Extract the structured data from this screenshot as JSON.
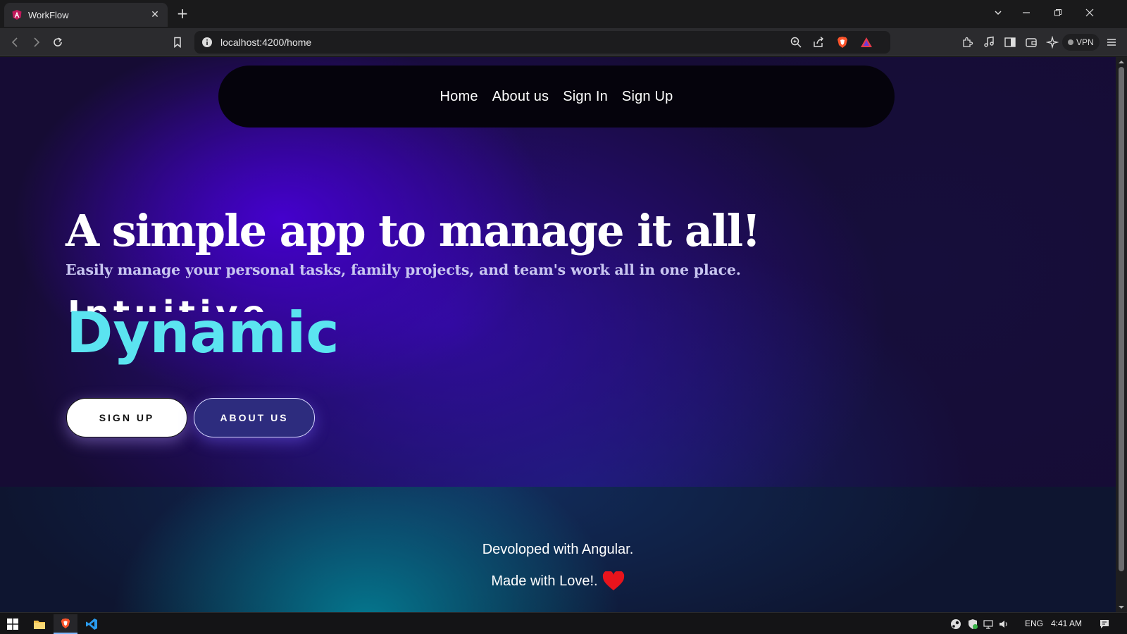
{
  "browser": {
    "tab_title": "WorkFlow",
    "tab_close": "✕",
    "new_tab": "+",
    "url": "localhost:4200/home",
    "vpn_label": "VPN"
  },
  "page": {
    "nav": {
      "links": [
        "Home",
        "About us",
        "Sign In",
        "Sign Up"
      ]
    },
    "hero": {
      "title": "A simple app to manage it all!",
      "subtitle": "Easily manage your personal tasks, family projects, and team's work all in one place.",
      "rotating_word_top": "Intuitive",
      "rotating_word_main": "Dynamic",
      "accent_color": "#5be4f0"
    },
    "buttons": {
      "signup": "SIGN UP",
      "about": "ABOUT US"
    },
    "footer": {
      "line1": "Devoloped with Angular.",
      "line2": "Made with Love!."
    }
  },
  "taskbar": {
    "language": "ENG",
    "time": "4:41 AM"
  },
  "icons": {
    "heart_color": "#e8141c",
    "brave_color": "#fb542b"
  }
}
